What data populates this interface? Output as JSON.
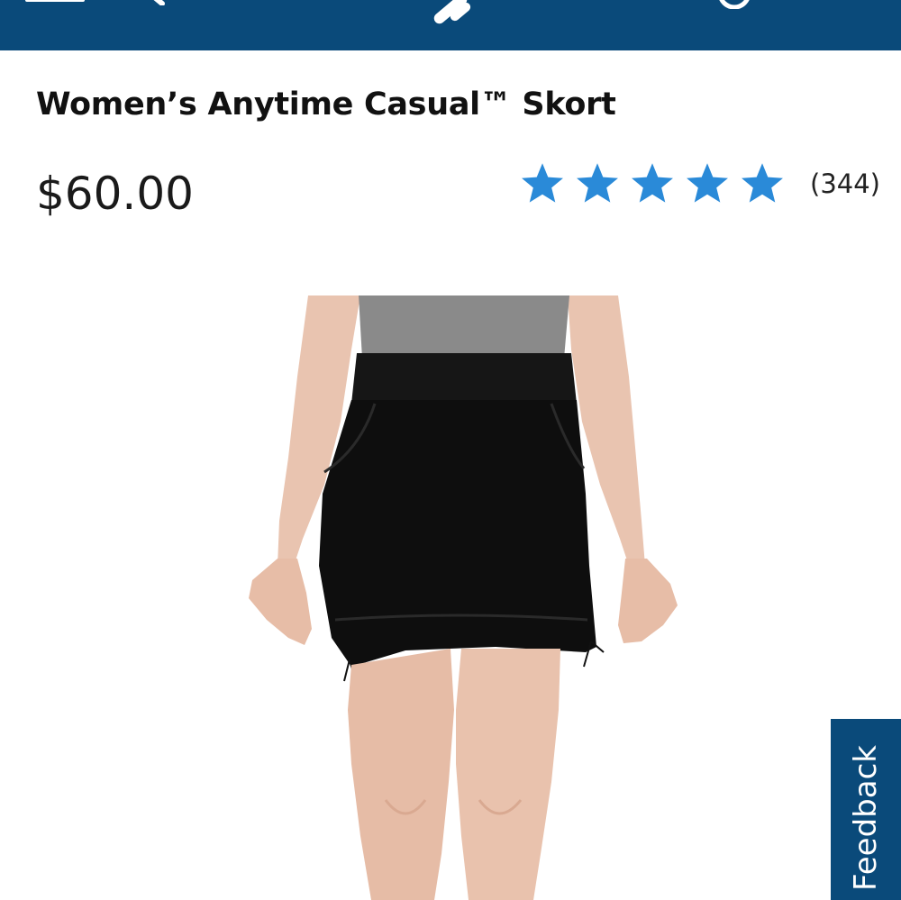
{
  "header": {
    "background_color": "#0a4a7a",
    "icons": [
      "menu-icon",
      "search-icon",
      "brand-logo-icon",
      "account-icon",
      "cart-icon"
    ]
  },
  "product": {
    "title": "Women’s Anytime Casual™ Skort",
    "price": "$60.00",
    "rating": {
      "stars": 5,
      "max_stars": 5,
      "star_color": "#2a8ad8",
      "review_count": "(344)"
    },
    "image": {
      "subject": "product-photo",
      "skort_color": "#111111",
      "shirt_color": "#8a8a8a"
    }
  },
  "feedback": {
    "label": "Feedback",
    "background_color": "#0a4a7a"
  }
}
